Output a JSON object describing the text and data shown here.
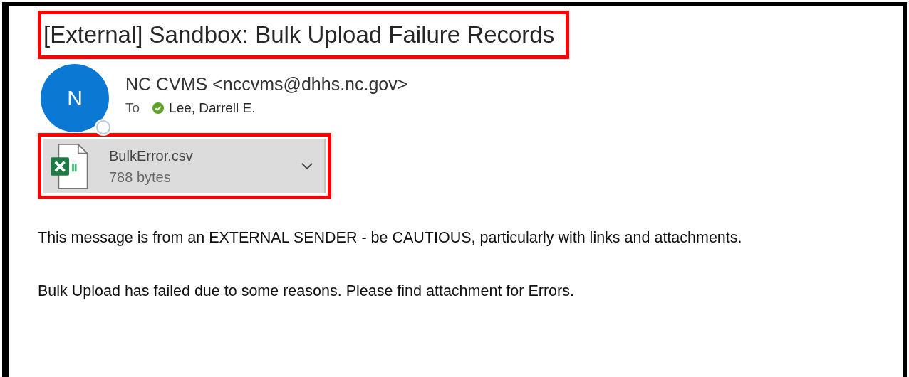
{
  "message": {
    "subject": "[External] Sandbox: Bulk Upload Failure Records",
    "subject_highlighted": true,
    "sender": {
      "initial": "N",
      "name": "NC CVMS <nccvms@dhhs.nc.gov>",
      "to_label": "To",
      "recipient": "Lee, Darrell E."
    },
    "attachment": {
      "name": "BulkError.csv",
      "size": "788 bytes",
      "highlighted": true
    },
    "body": [
      "This message is from an EXTERNAL SENDER - be CAUTIOUS, particularly with links and attachments.",
      "Bulk Upload has failed due to some reasons. Please find attachment for Errors."
    ]
  }
}
